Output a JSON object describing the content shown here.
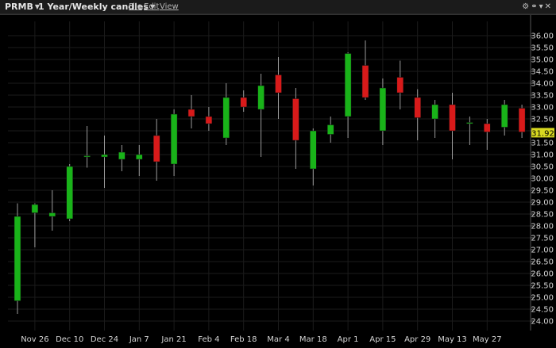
{
  "header": {
    "symbol": "PRMB",
    "period": "1 Year/Weekly candles",
    "menu": [
      {
        "label": "File"
      },
      {
        "label": "Edit"
      },
      {
        "label": "View"
      }
    ],
    "icons": [
      "gear-icon",
      "link-icon",
      "dropdown-icon",
      "close-icon"
    ]
  },
  "chart_data": {
    "type": "candlestick",
    "current_price": "31.92",
    "ylim": [
      23.6,
      36.6
    ],
    "y_ticks": [
      "24.00",
      "24.50",
      "25.00",
      "25.50",
      "26.00",
      "26.50",
      "27.00",
      "27.50",
      "28.00",
      "28.50",
      "29.00",
      "29.50",
      "30.00",
      "30.50",
      "31.00",
      "31.50",
      "32.00",
      "32.50",
      "33.00",
      "33.50",
      "34.00",
      "34.50",
      "35.00",
      "35.50",
      "36.00"
    ],
    "x_labels": [
      {
        "i": 1,
        "label": "Nov 26"
      },
      {
        "i": 3,
        "label": "Dec 10"
      },
      {
        "i": 5,
        "label": "Dec 24"
      },
      {
        "i": 7,
        "label": "Jan 7"
      },
      {
        "i": 9,
        "label": "Jan 21"
      },
      {
        "i": 11,
        "label": "Feb 4"
      },
      {
        "i": 13,
        "label": "Feb 18"
      },
      {
        "i": 15,
        "label": "Mar 4"
      },
      {
        "i": 17,
        "label": "Mar 18"
      },
      {
        "i": 19,
        "label": "Apr 1"
      },
      {
        "i": 21,
        "label": "Apr 15"
      },
      {
        "i": 23,
        "label": "Apr 29"
      },
      {
        "i": 25,
        "label": "May 13"
      },
      {
        "i": 27,
        "label": "May 27"
      }
    ],
    "candles": [
      {
        "o": 24.85,
        "h": 28.95,
        "l": 24.3,
        "c": 28.4
      },
      {
        "o": 28.55,
        "h": 28.95,
        "l": 27.1,
        "c": 28.9
      },
      {
        "o": 28.4,
        "h": 29.5,
        "l": 27.8,
        "c": 28.55
      },
      {
        "o": 28.3,
        "h": 30.6,
        "l": 28.2,
        "c": 30.5
      },
      {
        "o": 30.95,
        "h": 32.2,
        "l": 30.45,
        "c": 30.95
      },
      {
        "o": 30.9,
        "h": 31.8,
        "l": 29.6,
        "c": 31.0
      },
      {
        "o": 30.8,
        "h": 31.4,
        "l": 30.3,
        "c": 31.1
      },
      {
        "o": 30.8,
        "h": 31.4,
        "l": 30.1,
        "c": 31.0
      },
      {
        "o": 31.8,
        "h": 32.5,
        "l": 29.9,
        "c": 30.7
      },
      {
        "o": 30.6,
        "h": 32.9,
        "l": 30.1,
        "c": 32.7
      },
      {
        "o": 32.9,
        "h": 33.5,
        "l": 32.1,
        "c": 32.6
      },
      {
        "o": 32.6,
        "h": 33.0,
        "l": 32.0,
        "c": 32.3
      },
      {
        "o": 31.7,
        "h": 34.0,
        "l": 31.4,
        "c": 33.4
      },
      {
        "o": 33.4,
        "h": 33.7,
        "l": 32.8,
        "c": 33.0
      },
      {
        "o": 32.9,
        "h": 34.4,
        "l": 30.9,
        "c": 33.9
      },
      {
        "o": 34.35,
        "h": 35.1,
        "l": 32.5,
        "c": 33.6
      },
      {
        "o": 33.35,
        "h": 33.8,
        "l": 30.4,
        "c": 31.6
      },
      {
        "o": 30.4,
        "h": 32.1,
        "l": 29.7,
        "c": 32.0
      },
      {
        "o": 31.85,
        "h": 32.6,
        "l": 31.5,
        "c": 32.25
      },
      {
        "o": 32.6,
        "h": 35.3,
        "l": 31.7,
        "c": 35.25
      },
      {
        "o": 34.75,
        "h": 35.8,
        "l": 33.3,
        "c": 33.4
      },
      {
        "o": 32.0,
        "h": 34.2,
        "l": 31.4,
        "c": 33.8
      },
      {
        "o": 34.25,
        "h": 34.95,
        "l": 32.9,
        "c": 33.6
      },
      {
        "o": 33.4,
        "h": 33.75,
        "l": 31.6,
        "c": 32.55
      },
      {
        "o": 32.5,
        "h": 33.3,
        "l": 31.7,
        "c": 33.1
      },
      {
        "o": 33.1,
        "h": 33.6,
        "l": 30.8,
        "c": 32.0
      },
      {
        "o": 32.3,
        "h": 32.6,
        "l": 31.4,
        "c": 32.35
      },
      {
        "o": 32.3,
        "h": 32.5,
        "l": 31.2,
        "c": 31.95
      },
      {
        "o": 32.15,
        "h": 33.3,
        "l": 31.8,
        "c": 33.1
      },
      {
        "o": 32.95,
        "h": 33.1,
        "l": 31.7,
        "c": 31.95
      }
    ],
    "colors": {
      "up": "#19b319",
      "down": "#d81a1a",
      "wick": "#9a9a9a",
      "grid": "#1b1b1b",
      "axis_text": "#d4d4d4",
      "price_tag": "#d8d820"
    }
  }
}
